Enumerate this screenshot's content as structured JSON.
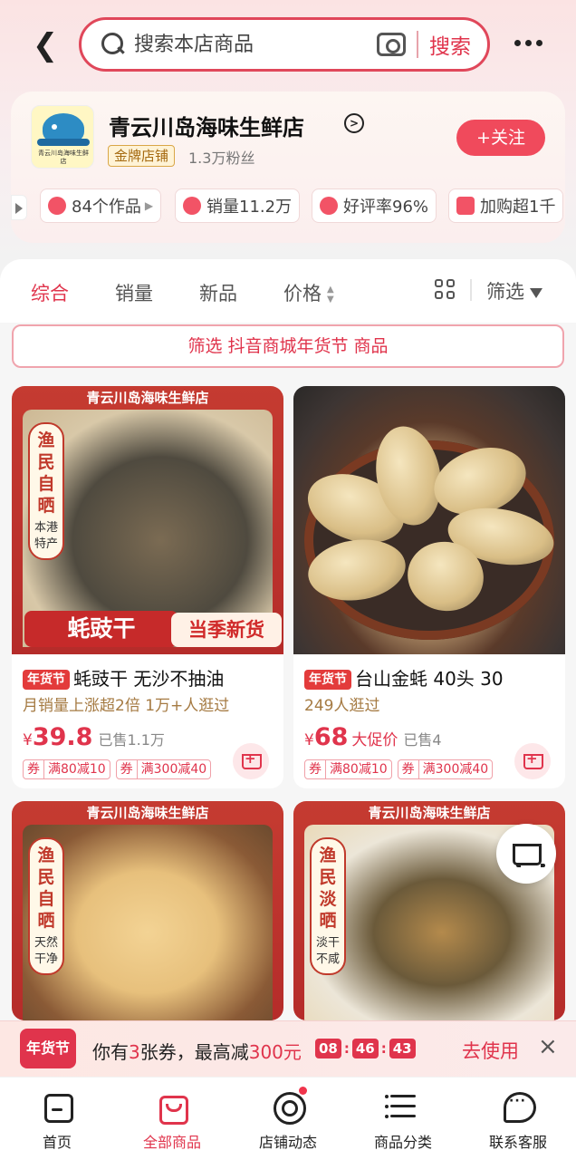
{
  "header": {
    "search_placeholder": "搜索本店商品",
    "search_button": "搜索"
  },
  "shop": {
    "logo_text": "青云川岛海味生鲜店",
    "name": "青云川岛海味生鲜店",
    "badge": "金牌店铺",
    "fans": "1.3万粉丝",
    "follow": "+关注",
    "stats": [
      {
        "label": "84个作品",
        "icon": "play-icon"
      },
      {
        "label": "销量11.2万",
        "icon": "up-arrow-icon"
      },
      {
        "label": "好评率96%",
        "icon": "heart-icon"
      },
      {
        "label": "加购超1千",
        "icon": "cart-icon"
      }
    ]
  },
  "sort": {
    "tabs": [
      "综合",
      "销量",
      "新品",
      "价格"
    ],
    "active_index": 0,
    "filter_label": "筛选"
  },
  "promo_filter": "筛选 抖音商城年货节 商品",
  "products": [
    {
      "image_shop": "青云川岛海味生鲜店",
      "tag_big": "渔民自晒",
      "tag_small": "本港特产",
      "image_title": "蚝豉干",
      "image_badge": "当季新货",
      "event_tag": "年货节",
      "title": "蚝豉干 无沙不抽油",
      "subtitle": "月销量上涨超2倍  1万+人逛过",
      "price_symbol": "¥",
      "price": "39.8",
      "price_tip": "",
      "sold": "已售1.1万",
      "coupons": [
        {
          "q": "券",
          "t": "满80减10"
        },
        {
          "q": "券",
          "t": "满300减40"
        }
      ]
    },
    {
      "event_tag": "年货节",
      "title": "台山金蚝 40头 30",
      "subtitle": "249人逛过",
      "price_symbol": "¥",
      "price": "68",
      "price_tip": "大促价",
      "sold": "已售4",
      "coupons": [
        {
          "q": "券",
          "t": "满80减10"
        },
        {
          "q": "券",
          "t": "满300减40"
        }
      ]
    },
    {
      "image_shop": "青云川岛海味生鲜店",
      "tag_big": "渔民自晒",
      "tag_small": "天然干净"
    },
    {
      "image_shop": "青云川岛海味生鲜店",
      "tag_big": "渔民淡晒",
      "tag_small": "淡干不咸"
    }
  ],
  "coupon_bar": {
    "event": "年货节",
    "text_prefix": "你有",
    "count": "3",
    "text_mid": "张券，最高减",
    "amount": "300元",
    "timer": [
      "08",
      "46",
      "43"
    ],
    "use": "去使用",
    "close": "×"
  },
  "tabbar": [
    {
      "label": "首页",
      "icon": "home-icon"
    },
    {
      "label": "全部商品",
      "icon": "bag-icon"
    },
    {
      "label": "店铺动态",
      "icon": "dynamic-icon"
    },
    {
      "label": "商品分类",
      "icon": "category-icon"
    },
    {
      "label": "联系客服",
      "icon": "chat-icon"
    }
  ],
  "colors": {
    "accent": "#e0344c",
    "frame_red": "#c53b31",
    "coupon_text": "#a57a42"
  }
}
